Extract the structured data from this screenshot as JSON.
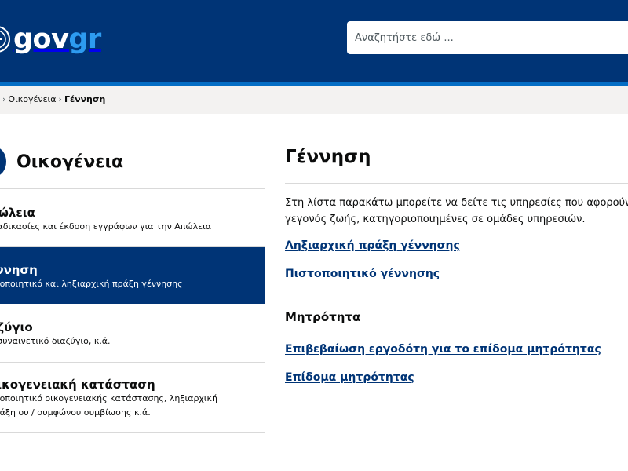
{
  "header": {
    "logo": {
      "gov": "gov",
      "gr": "gr"
    },
    "search": {
      "placeholder": "Αναζητήστε εδώ ..."
    }
  },
  "breadcrumb": {
    "items": [
      "Οικογένεια"
    ],
    "current": "Γέννηση"
  },
  "sidebar": {
    "title": "Οικογένεια",
    "items": [
      {
        "title": "πώλεια",
        "description": "διαδικασίες και έκδοση εγγράφων για την Απώλεια",
        "active": false
      },
      {
        "title": "έννηση",
        "description": "στοποιητικό και ληξιαρχική πράξη γέννησης",
        "active": true
      },
      {
        "title": "αζύγιο",
        "description": "ο συναινετικό διαζύγιο, κ.ά.",
        "active": false
      },
      {
        "title": "οικογενειακή κατάσταση",
        "description": "στοποιητικό οικογενειακής κατάστασης, ληξιαρχική πράξη ου / συμφώνου συμβίωσης κ.ά.",
        "active": false
      }
    ]
  },
  "main": {
    "title": "Γέννηση",
    "intro": "Στη λίστα παρακάτω μπορείτε να δείτε τις υπηρεσίες που αφορούν το γεγονός ζωής, κατηγοριοποιημένες σε ομάδες υπηρεσιών.",
    "links": [
      "Ληξιαρχική πράξη γέννησης",
      "Πιστοποιητικό γέννησης"
    ],
    "group": {
      "title": "Μητρότητα",
      "links": [
        "Επιβεβαίωση εργοδότη για το επίδομα μητρότητας",
        "Επίδομα μητρότητας"
      ]
    }
  },
  "colors": {
    "header": "#003476",
    "accent": "#046ec5",
    "logo_gr": "#2d9bf0",
    "active_item": "#003476",
    "link": "#003476",
    "breadcrumb_bg": "#f3f2f1"
  },
  "icons": {
    "emblem": "greek-emblem-icon",
    "breadcrumb_separator": "chevron-right-icon",
    "sidebar": "family-icon"
  }
}
